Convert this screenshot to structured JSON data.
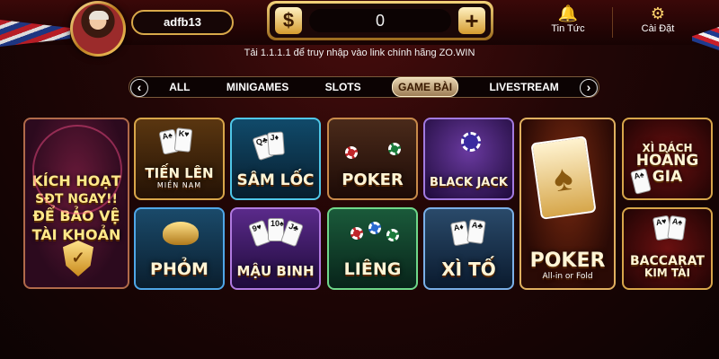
{
  "header": {
    "username": "adfb13",
    "balance": "0",
    "coin_symbol": "$",
    "add_symbol": "+",
    "news_label": "Tin Tức",
    "settings_label": "Cài Đặt"
  },
  "notice": "Tải 1.1.1.1 để truy nhập vào link chính hãng ZO.WIN",
  "tabs": [
    {
      "label": "ALL"
    },
    {
      "label": "MINIGAMES"
    },
    {
      "label": "SLOTS"
    },
    {
      "label": "GAME BÀI"
    },
    {
      "label": "LIVESTREAM"
    }
  ],
  "active_tab": "GAME BÀI",
  "promo": {
    "line1": "KÍCH HOẠT",
    "line2": "SĐT NGAY!!",
    "line3": "ĐỂ BẢO VỆ",
    "line4": "TÀI KHOẢN"
  },
  "games": {
    "tienlen": {
      "title": "TIẾN LÊN",
      "sub": "MIỀN NAM"
    },
    "samloc": {
      "title": "SÂM LỐC"
    },
    "poker": {
      "title": "POKER"
    },
    "blackjack": {
      "title": "BLACK JACK"
    },
    "phom": {
      "title": "PHỎM"
    },
    "maubinh": {
      "title": "MẬU BINH"
    },
    "lieng": {
      "title": "LIÊNG"
    },
    "xito": {
      "title": "XÌ TỐ"
    },
    "pokerbig": {
      "title": "POKER",
      "sub": "All-in or Fold"
    },
    "xidach": {
      "line1": "XÌ DÁCH",
      "line2": "HOÀNG",
      "line3": "GIA"
    },
    "baccarat": {
      "line1": "BACCARAT",
      "line2": "KIM TÀI"
    }
  },
  "icons": {
    "news": "bell-icon",
    "settings": "gear-icon",
    "left": "chevron-left-icon",
    "right": "chevron-right-icon"
  },
  "colors": {
    "gold": "#d9a94a",
    "background": "#220606",
    "active_tab": "#e9d6b2"
  }
}
